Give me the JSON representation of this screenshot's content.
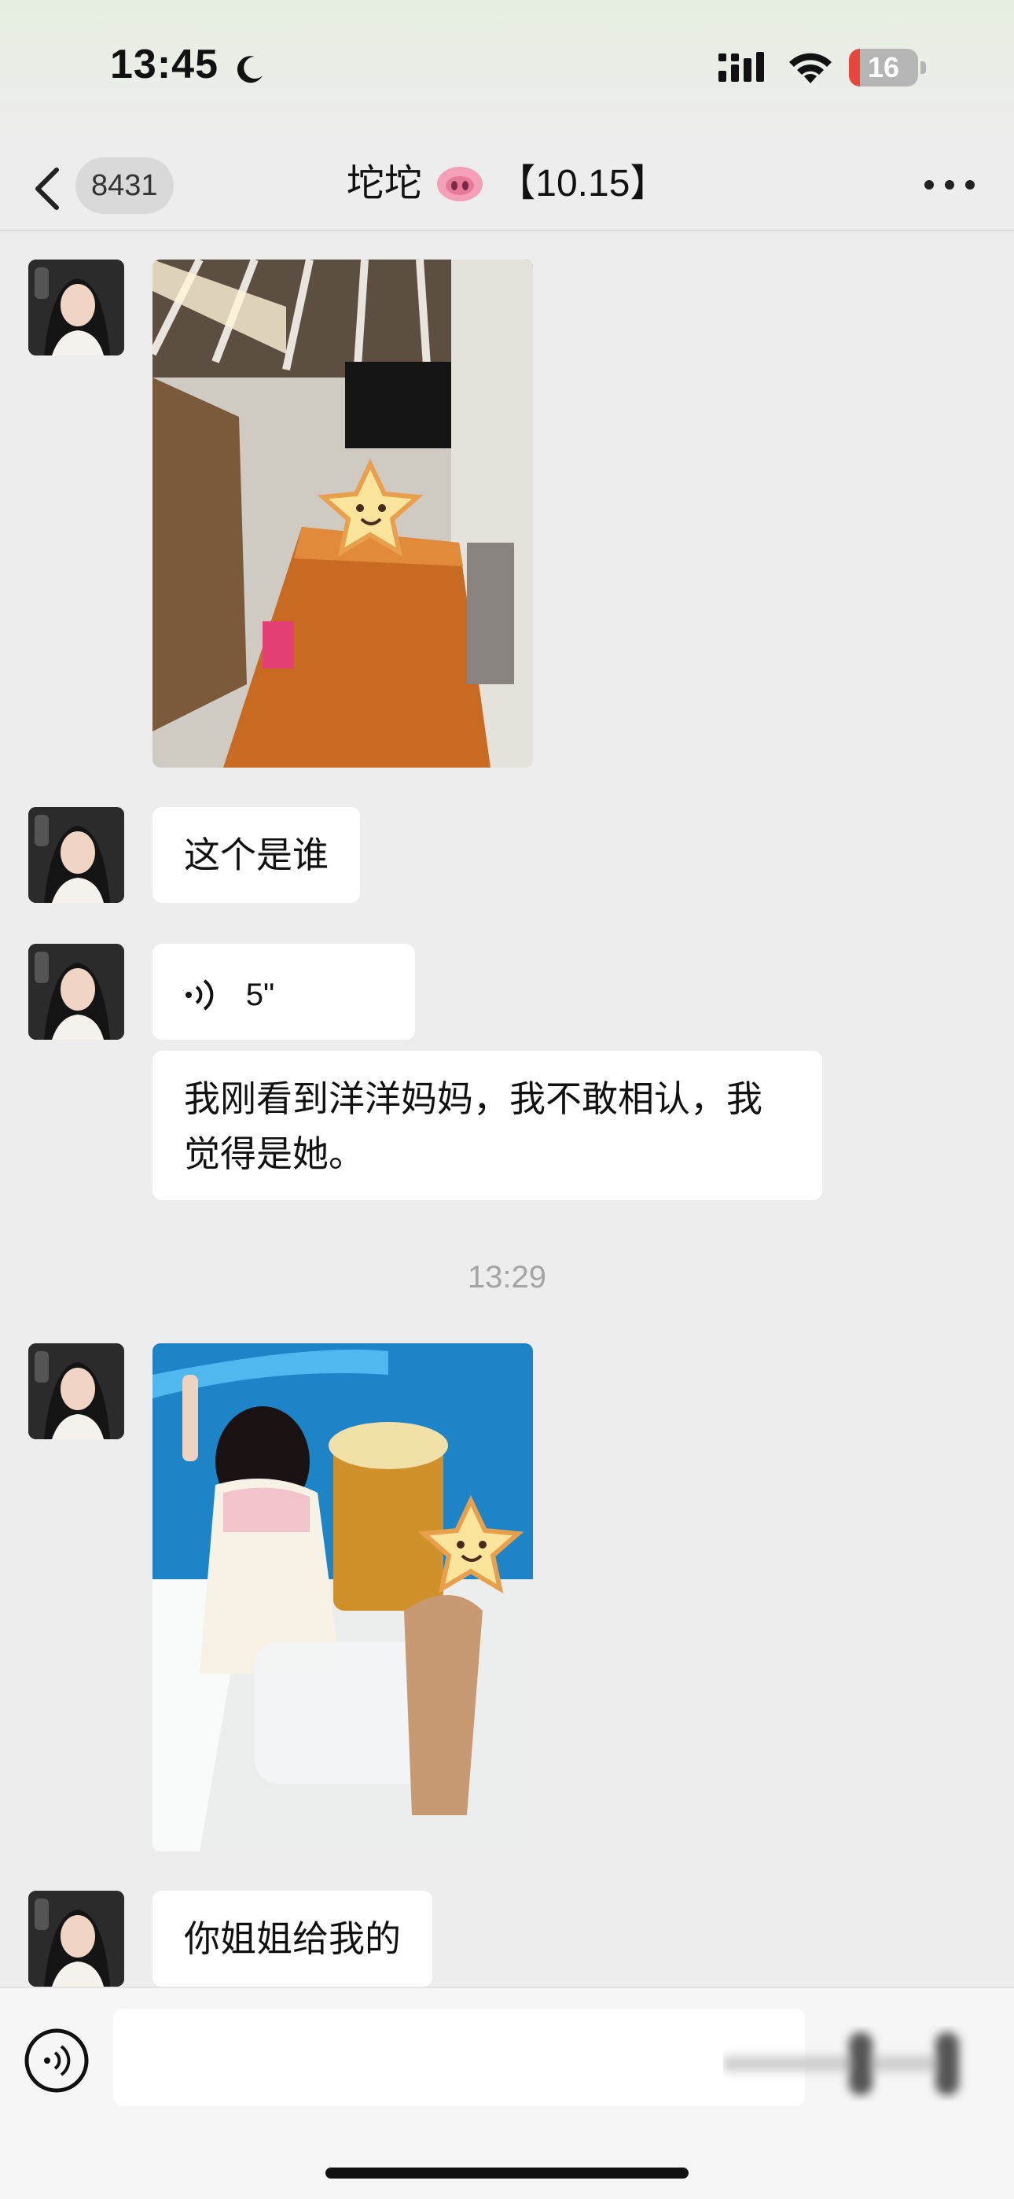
{
  "status_bar": {
    "time": "13:45",
    "battery_level": "16",
    "battery_fraction": 0.16,
    "icons": [
      "moon-icon",
      "cellular-signal-icon",
      "wifi-icon",
      "battery-icon"
    ]
  },
  "header": {
    "unread_count": "8431",
    "title_prefix": "坨坨",
    "title_emoji": "pig-nose-icon",
    "title_suffix": "【10.15】",
    "icons": [
      "back-chevron-icon",
      "more-icon"
    ]
  },
  "messages": [
    {
      "type": "image",
      "description": "photo-cafe-table-with-star-sticker"
    },
    {
      "type": "text",
      "text": "这个是谁"
    },
    {
      "type": "voice",
      "duration": "5\""
    },
    {
      "type": "text",
      "text": "我刚看到洋洋妈妈，我不敢相认，我觉得是她。"
    },
    {
      "type": "timestamp",
      "text": "13:29"
    },
    {
      "type": "image",
      "description": "photo-girl-and-drink-cup-with-star-sticker"
    },
    {
      "type": "text",
      "text": "你姐姐给我的"
    }
  ],
  "input_bar": {
    "placeholder": "",
    "icons": [
      "voice-input-icon"
    ]
  },
  "colors": {
    "background": "#ededed",
    "bubble": "#ffffff",
    "battery_low": "#e8453c",
    "timestamp": "#a4a4a4"
  }
}
